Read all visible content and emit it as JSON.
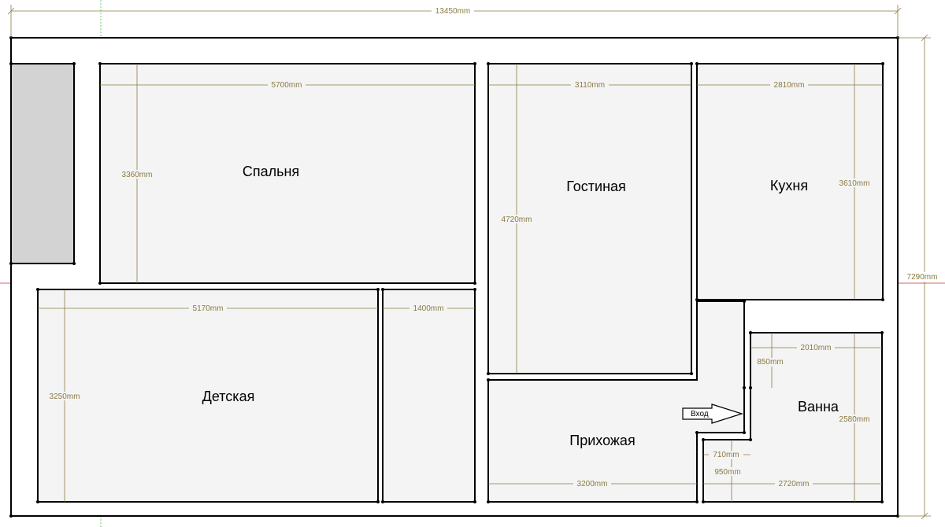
{
  "colors": {
    "wall": "#ffffff",
    "wall_stroke": "#000000",
    "room_fill": "#f4f4f4",
    "balcony_fill": "#d3d3d3",
    "dimension": "#8a7a45",
    "axis_red": "#c83232",
    "axis_green": "#2eb82e"
  },
  "overall": {
    "width_label": "13450mm",
    "height_label": "7290mm"
  },
  "rooms": {
    "bedroom": "Спальня",
    "living_room": "Гостиная",
    "kitchen": "Кухня",
    "kids_room": "Детская",
    "hallway": "Прихожая",
    "bathroom": "Ванна"
  },
  "entrance": {
    "label": "Вход",
    "icon": "arrow-right-icon"
  },
  "dimensions": {
    "bedroom_width": "5700mm",
    "bedroom_height": "3360mm",
    "living_width": "3110mm",
    "living_height": "4720mm",
    "kitchen_width": "2810mm",
    "kitchen_height": "3610mm",
    "kids_width": "5170mm",
    "kids_height": "3250mm",
    "closet_width": "1400mm",
    "bath_width": "2010mm",
    "bath_step": "850mm",
    "bath_height": "2580mm",
    "hall_width": "3200mm",
    "niche_width": "710mm",
    "niche_depth": "950mm",
    "bath_bottom_width": "2720mm"
  }
}
